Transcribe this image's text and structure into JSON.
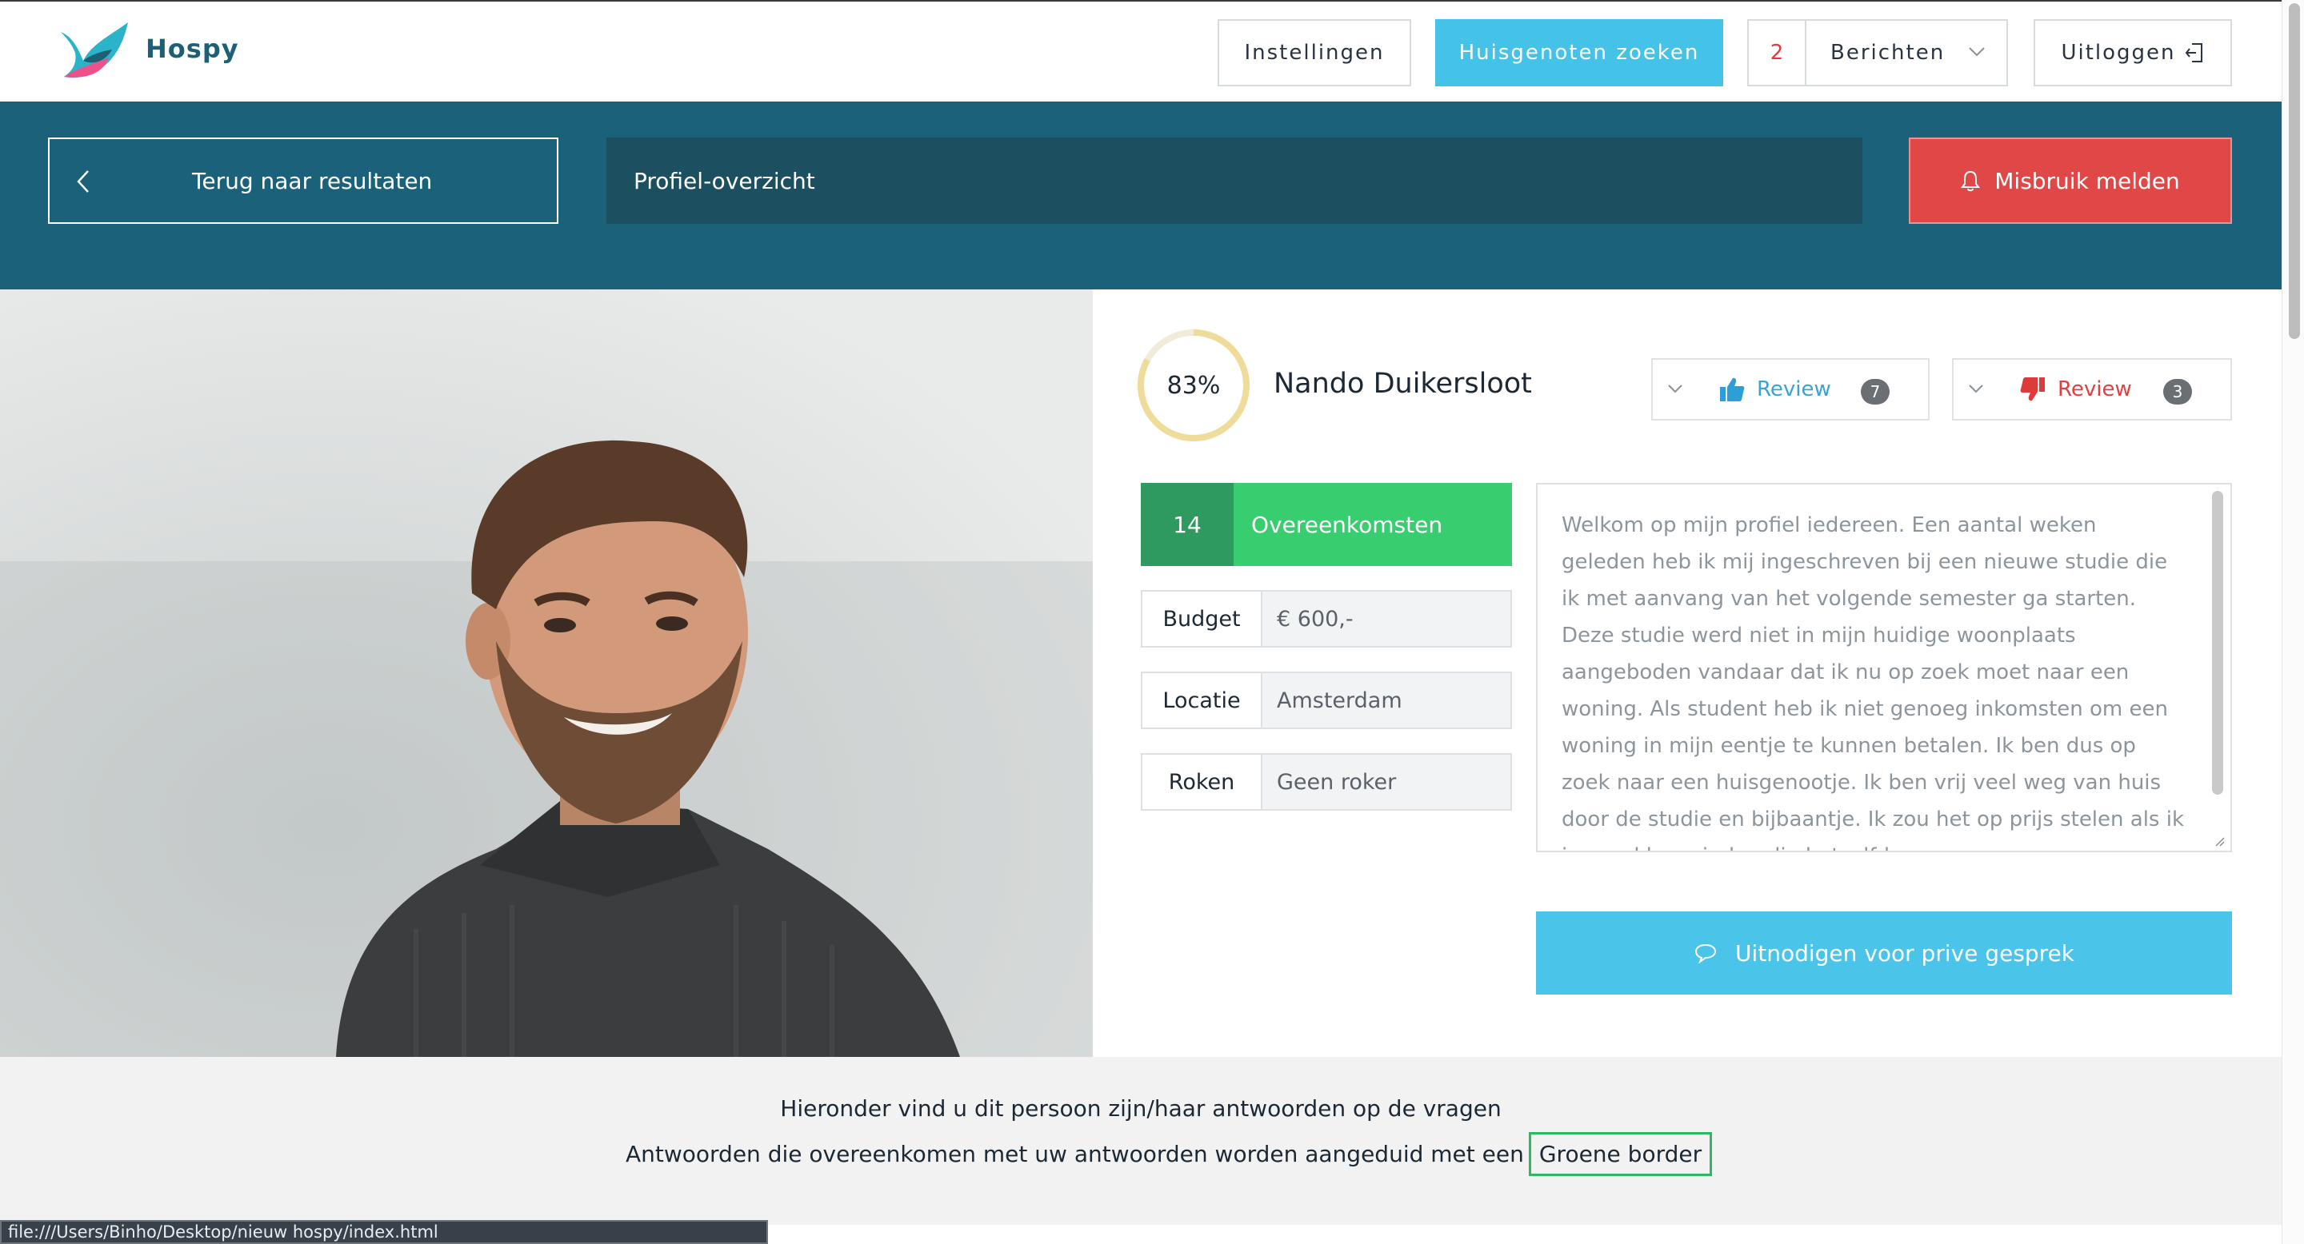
{
  "header": {
    "brand": "Hospy",
    "settings_label": "Instellingen",
    "search_label": "Huisgenoten zoeken",
    "messages_count": "2",
    "messages_label": "Berichten",
    "logout_label": "Uitloggen"
  },
  "toolbar": {
    "back_label": "Terug naar resultaten",
    "title": "Profiel-overzicht",
    "report_label": "Misbruik melden"
  },
  "profile": {
    "match_percent": "83%",
    "match_fraction": 0.83,
    "name": "Nando Duikersloot",
    "reviews": {
      "positive_label": "Review",
      "positive_count": "7",
      "negative_label": "Review",
      "negative_count": "3"
    },
    "matches_count": "14",
    "matches_label": "Overeenkomsten",
    "fields": [
      {
        "label": "Budget",
        "value": "€ 600,-"
      },
      {
        "label": "Locatie",
        "value": "Amsterdam"
      },
      {
        "label": "Roken",
        "value": "Geen roker"
      }
    ],
    "bio": "Welkom op mijn profiel iedereen. Een aantal weken geleden heb ik mij ingeschreven bij een nieuwe studie die ik met aanvang van het volgende semester ga starten. Deze studie werd niet in mijn huidige woonplaats aangeboden vandaar dat ik nu op zoek moet naar een woning. Als student heb ik niet genoeg inkomsten om een woning in mijn eentje te kunnen betalen. Ik ben dus op zoek naar een huisgenootje. Ik ben vrij veel weg van huis door de studie en bijbaantje. Ik zou het op prijs stelen als ik iemand kon vinden die hetzelfde",
    "invite_label": "Uitnodigen voor prive gesprek"
  },
  "answers_info": {
    "line1": "Hieronder vind u dit persoon zijn/haar antwoorden op de vragen",
    "line2": "Antwoorden die overeenkomen met uw antwoorden worden aangeduid met een",
    "highlight": "Groene border"
  },
  "statusbar": {
    "url": "file:///Users/Binho/Desktop/nieuw hospy/index.html"
  },
  "colors": {
    "brand_teal": "#1b6179",
    "accent_blue": "#45c2e8",
    "report_red": "#e04848",
    "match_green": "#38ce70",
    "ring_gold": "#f2e6b8"
  },
  "icons": {
    "logo": "bird-logo-icon",
    "logout": "logout-icon",
    "back": "chevron-left-icon",
    "report": "bell-icon",
    "thumb_up": "thumbs-up-icon",
    "thumb_down": "thumbs-down-icon",
    "invite": "chat-bubble-icon"
  }
}
